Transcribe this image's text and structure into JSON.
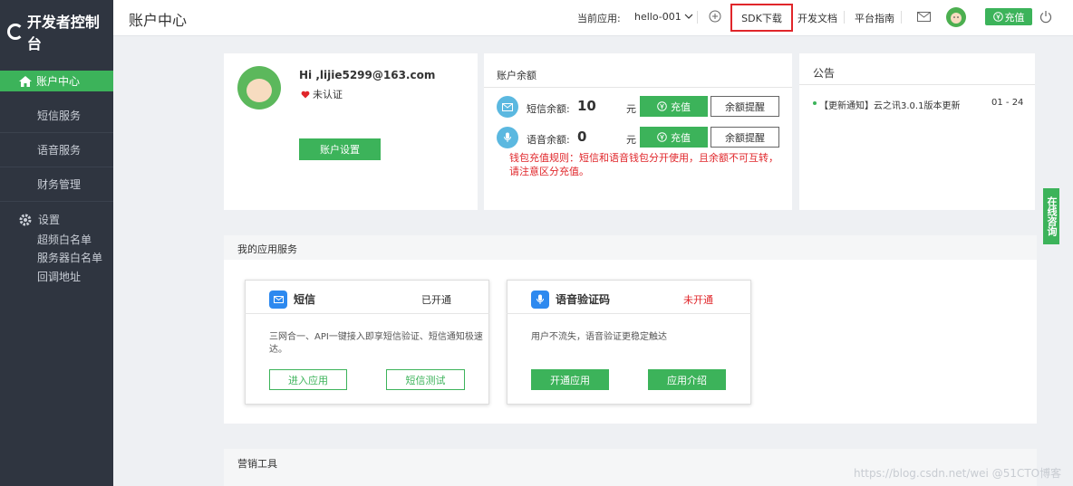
{
  "sidebar": {
    "brand": "开发者控制台",
    "active_item": "账户中心",
    "items": [
      {
        "label": "短信服务"
      },
      {
        "label": "语音服务"
      },
      {
        "label": "财务管理"
      }
    ],
    "settings_label": "设置",
    "sub_items": [
      {
        "label": "超频白名单"
      },
      {
        "label": "服务器白名单"
      },
      {
        "label": "回调地址"
      }
    ]
  },
  "header": {
    "title": "账户中心",
    "current_app_label": "当前应用:",
    "current_app_value": "hello-001",
    "sdk_download": "SDK下载",
    "dev_docs": "开发文档",
    "platform_guide": "平台指南",
    "recharge": "充值"
  },
  "account": {
    "greeting": "Hi ,lijie5299@163.com",
    "verify_status": "未认证",
    "settings_button": "账户设置"
  },
  "balance": {
    "title": "账户余额",
    "sms_label": "短信余额:",
    "sms_value": "10",
    "voice_label": "语音余额:",
    "voice_value": "0",
    "unit": "元",
    "recharge_label": "充值",
    "alert_label": "余额提醒",
    "rule_text": "钱包充值规则：短信和语音钱包分开使用，且余额不可互转，请注意区分充值。"
  },
  "notice": {
    "title": "公告",
    "items": [
      {
        "text": "【更新通知】云之讯3.0.1版本更新",
        "date": "01 - 24"
      }
    ]
  },
  "services": {
    "title": "我的应用服务",
    "cards": [
      {
        "name": "短信",
        "status": "已开通",
        "desc": "三网合一、API一键接入即享短信验证、短信通知极速达。",
        "btn1": "进入应用",
        "btn2": "短信测试"
      },
      {
        "name": "语音验证码",
        "status": "未开通",
        "desc": "用户不流失，语音验证更稳定触达",
        "btn1": "开通应用",
        "btn2": "应用介绍"
      }
    ]
  },
  "marketing": {
    "title": "营销工具"
  },
  "side_tab": "在线咨询",
  "watermark": "https://blog.csdn.net/wei @51CTO博客",
  "colors": {
    "accent": "#3cb35a",
    "sidebar_bg": "#2f3540",
    "highlight_border": "#e0262a",
    "warning_text": "#e0262a"
  }
}
